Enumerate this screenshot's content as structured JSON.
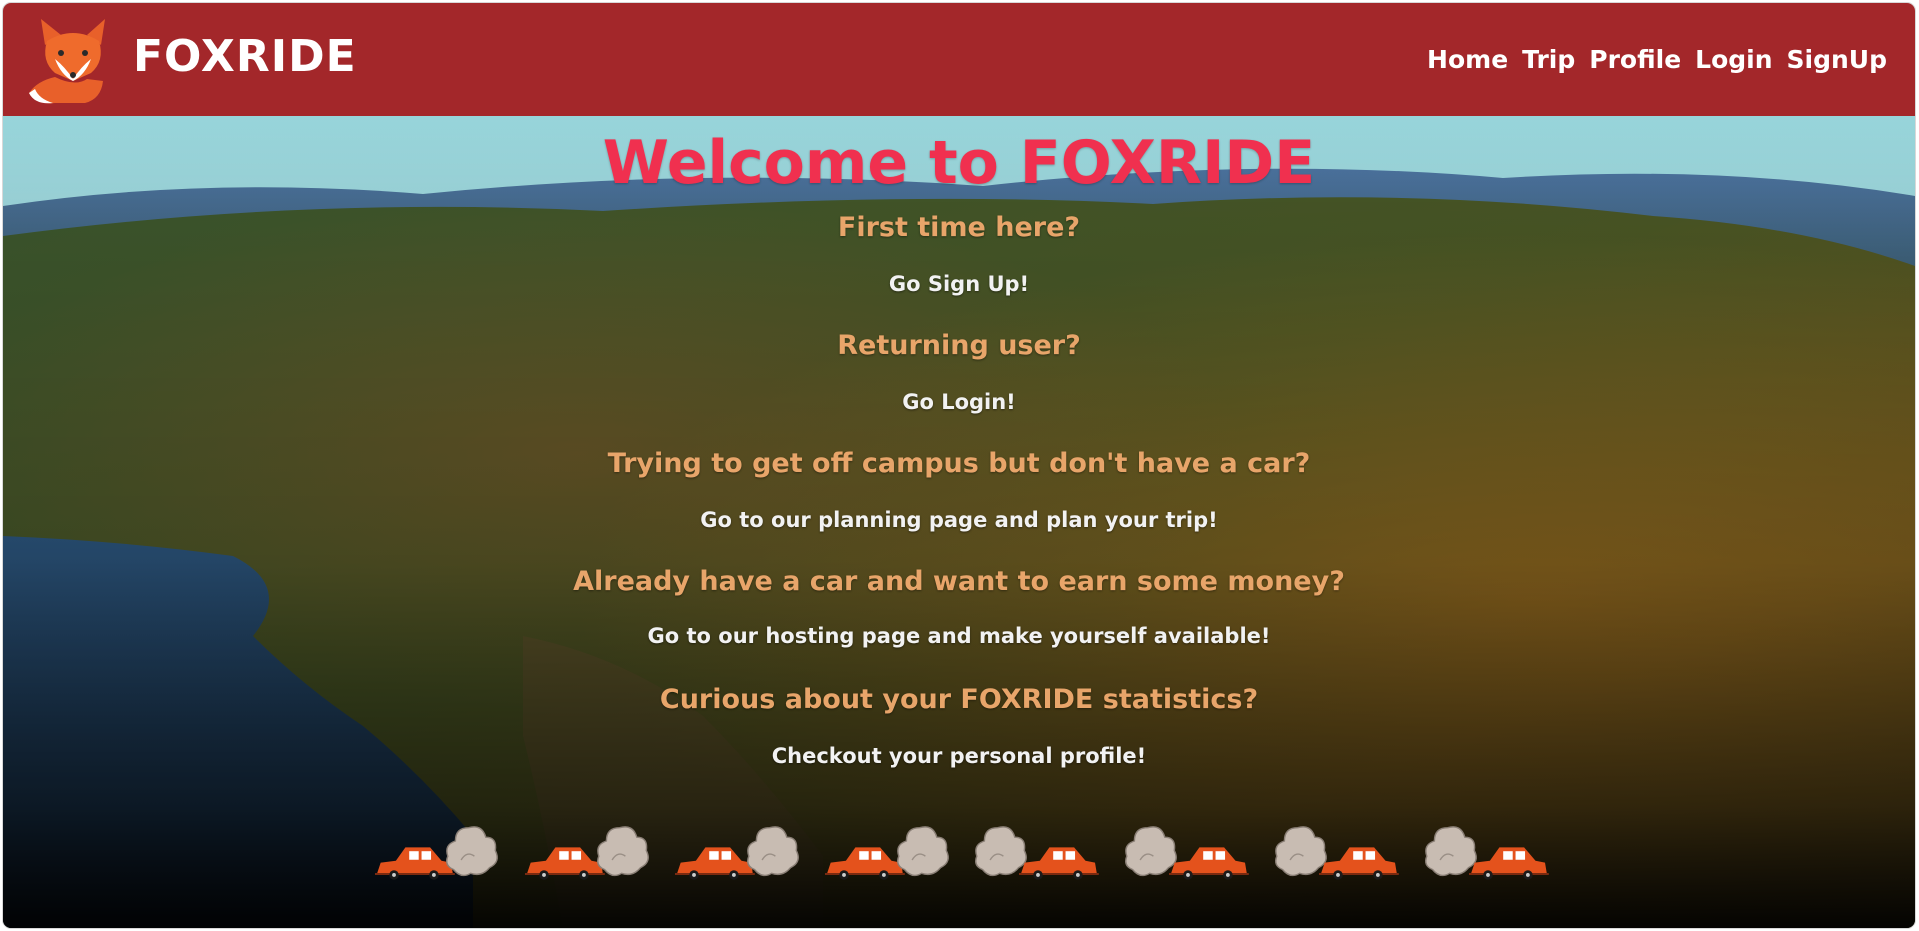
{
  "nav": {
    "brand": "FOXRIDE",
    "links": [
      "Home",
      "Trip",
      "Profile",
      "Login",
      "SignUp"
    ]
  },
  "hero": {
    "title": "Welcome to FOXRIDE",
    "sections": [
      {
        "question": "First time here?",
        "answer": "Go Sign Up!"
      },
      {
        "question": "Returning user?",
        "answer": "Go Login!"
      },
      {
        "question": "Trying to get off campus but don't have a car?",
        "answer": "Go to our planning page and plan your trip!"
      },
      {
        "question": "Already have a car and want to earn some money?",
        "answer": "Go to our hosting page and make yourself available!"
      },
      {
        "question": "Curious about your FOXRIDE statistics?",
        "answer": "Checkout your personal profile!"
      }
    ]
  },
  "icons": {
    "logo": "fox-logo-icon",
    "car": "car-icon",
    "smoke": "exhaust-cloud-icon"
  },
  "colors": {
    "navbar": "#a3272a",
    "title": "#f0304f",
    "question": "#e8a56a",
    "answer": "#f2f2f2",
    "car": "#e4521c",
    "smoke": "#c8bcb2"
  }
}
